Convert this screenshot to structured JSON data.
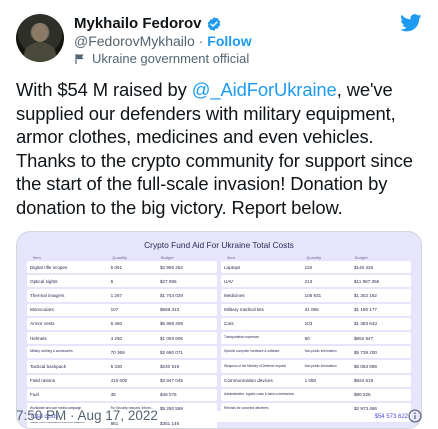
{
  "author": {
    "display_name": "Mykhailo Fedorov",
    "handle": "@FedorovMykhailo",
    "separator": "·",
    "follow_label": "Follow",
    "affiliation": "Ukraine government official"
  },
  "tweet": {
    "text_before": "With $54 M raised by ",
    "mention": "@_AidForUkraine",
    "text_after": ", we've supplied our defenders with military equipment, armor clothes, medicines and even vehicles. Thanks to the crypto community for support since the start of the full-scale invasion! Donation by donation to the big victory. Report below."
  },
  "media": {
    "title": "Crypto Fund Aid For Ukraine Total Costs",
    "headers": [
      "Item",
      "Quantity",
      "Budget"
    ],
    "left_rows": [
      {
        "item": "Digital rifle scopes",
        "qty": "5 061",
        "budget": "$2 956 252"
      },
      {
        "item": "Optical sights",
        "qty": "6",
        "budget": "$27 965"
      },
      {
        "item": "Thermal imagers",
        "qty": "1 267",
        "budget": "$1 744 029"
      },
      {
        "item": "Monoculars",
        "qty": "107",
        "budget": "$568 313"
      },
      {
        "item": "Armor vests",
        "qty": "6 460",
        "budget": "$6 969 309"
      },
      {
        "item": "Helmets",
        "qty": "4 250",
        "budget": "$1 003 606"
      },
      {
        "item": "Military clothing & accessories",
        "qty": "70 369",
        "budget": "$2 690 071"
      },
      {
        "item": "Tactical backpack",
        "qty": "5 330",
        "budget": "$240 919"
      },
      {
        "item": "Field rations",
        "qty": "410 000",
        "budget": "$3 847 045"
      },
      {
        "item": "Fuel",
        "qty": "35",
        "budget": "$48 075"
      },
      {
        "item": "Worldwide and war media campaign",
        "qty": "For Security reasons, inform...",
        "budget": "$5 250 559"
      },
      {
        "item": "Radio communication kits and stations",
        "qty": "861",
        "budget": "$351 146"
      }
    ],
    "right_rows": [
      {
        "item": "Laptops",
        "qty": "119",
        "budget": "$140 426"
      },
      {
        "item": "UAV",
        "qty": "213",
        "budget": "$11 987 356"
      },
      {
        "item": "Medicines",
        "qty": "105 831",
        "budget": "$1 302 162"
      },
      {
        "item": "Military medical kits",
        "qty": "31 065",
        "budget": "$1 190 177"
      },
      {
        "item": "Cars",
        "qty": "103",
        "budget": "$1 383 643"
      },
      {
        "item": "Transportation expenses",
        "qty": "60",
        "budget": "$852 947"
      },
      {
        "item": "Specific computer hardware & software",
        "qty": "Non-public information",
        "budget": "$5 739 200"
      },
      {
        "item": "Weapons of the Ministry of Defense request",
        "qty": "Non-public information",
        "budget": "$5 063 898"
      },
      {
        "item": "Communication devices",
        "qty": "1 050",
        "budget": "$924 619"
      },
      {
        "item": "Administrative, logistic costs & bank commissions",
        "qty": "",
        "budget": "$90 325"
      },
      {
        "item": "Refunds for canceled deliveries",
        "qty": "",
        "budget": "$2 973 486"
      }
    ],
    "total_label": "Total costs",
    "total_value": "$54 573 622"
  },
  "footer": {
    "timestamp": "7:50 PM · Aug 17, 2022"
  },
  "colors": {
    "accent": "#1d9bf0",
    "media_bg": "#e7e5fb",
    "total_text": "#4a46d8"
  }
}
